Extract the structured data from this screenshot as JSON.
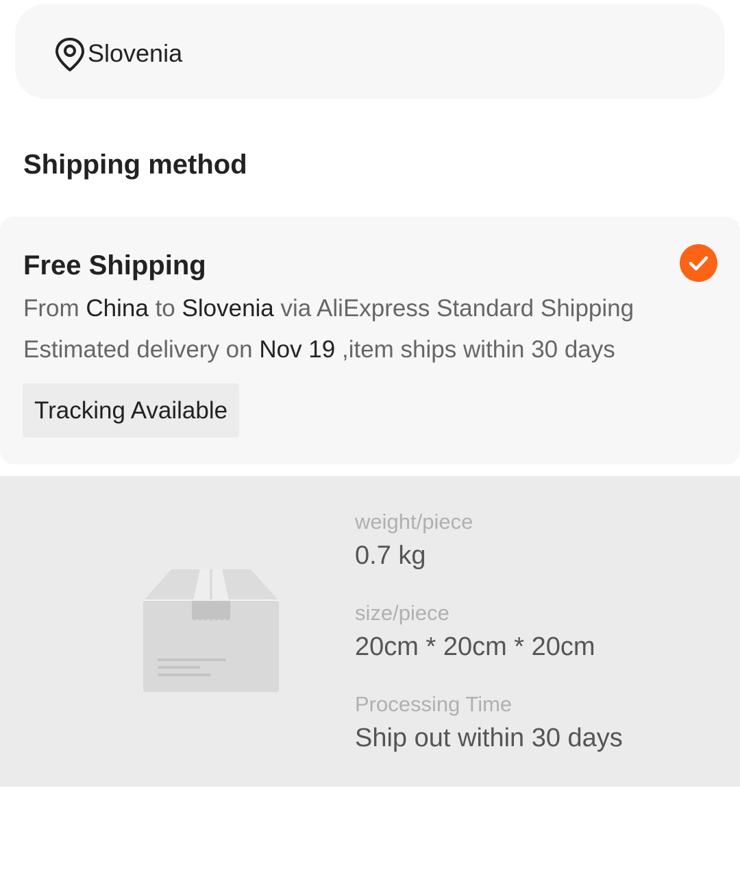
{
  "location": {
    "icon": "location-pin-icon",
    "country": "Slovenia"
  },
  "shipping": {
    "section_title": "Shipping method",
    "method": {
      "name": "Free Shipping",
      "selected": true,
      "check_color": "#fa6414",
      "route": {
        "from_label": "From",
        "origin": "China",
        "to_label": "to",
        "destination": "Slovenia",
        "via_label": "via AliExpress Standard Shipping"
      },
      "eta": {
        "prefix": "Estimated delivery on",
        "date": "Nov 19",
        "suffix": ",item ships within 30 days"
      },
      "tag": "Tracking Available"
    }
  },
  "package": {
    "illustration": "package-box-icon",
    "specs": [
      {
        "label": "weight/piece",
        "value": "0.7 kg"
      },
      {
        "label": "size/piece",
        "value": "20cm * 20cm * 20cm"
      },
      {
        "label": "Processing Time",
        "value": "Ship out within 30 days"
      }
    ]
  }
}
